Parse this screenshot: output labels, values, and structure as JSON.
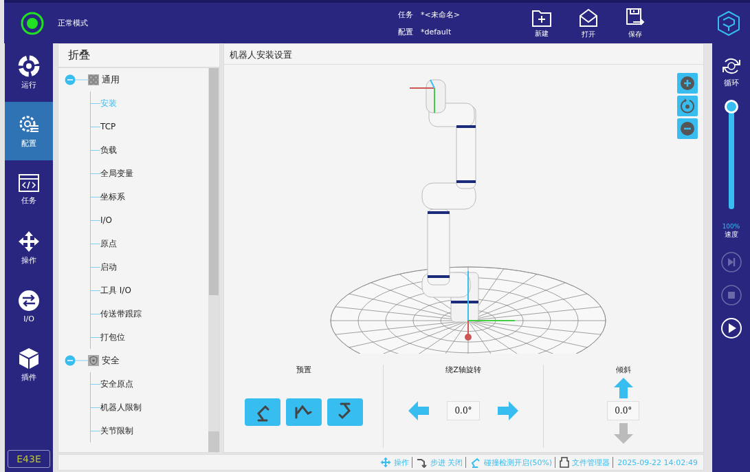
{
  "header": {
    "mode": {
      "label": "正常模式",
      "on": true
    },
    "task": {
      "label": "任务",
      "value": "*<未命名>"
    },
    "config": {
      "label": "配置",
      "value": "*default"
    },
    "actions": [
      {
        "kind": "new",
        "label": "新建"
      },
      {
        "kind": "open",
        "label": "打开"
      },
      {
        "kind": "save",
        "label": "保存"
      }
    ]
  },
  "nav": {
    "items": [
      {
        "kind": "run",
        "label": "运行",
        "selected": false
      },
      {
        "kind": "config",
        "label": "配置",
        "selected": true
      },
      {
        "kind": "task",
        "label": "任务",
        "selected": false
      },
      {
        "kind": "move",
        "label": "操作",
        "selected": false
      },
      {
        "kind": "io",
        "label": "I/O",
        "selected": false
      },
      {
        "kind": "plugin",
        "label": "插件",
        "selected": false
      }
    ],
    "code": "E43E"
  },
  "tree": {
    "title": "折叠",
    "groups": [
      {
        "kind": "general",
        "label": "通用",
        "expanded": true,
        "children": [
          {
            "label": "安装",
            "selected": true
          },
          {
            "label": "TCP",
            "selected": false
          },
          {
            "label": "负载",
            "selected": false
          },
          {
            "label": "全局变量",
            "selected": false
          },
          {
            "label": "坐标系",
            "selected": false
          },
          {
            "label": "I/O",
            "selected": false
          },
          {
            "label": "原点",
            "selected": false
          },
          {
            "label": "启动",
            "selected": false
          },
          {
            "label": "工具 I/O",
            "selected": false
          },
          {
            "label": "传送带跟踪",
            "selected": false
          },
          {
            "label": "打包位",
            "selected": false
          }
        ]
      },
      {
        "kind": "safety",
        "label": "安全",
        "expanded": true,
        "children": [
          {
            "label": "安全原点",
            "selected": false
          },
          {
            "label": "机器人限制",
            "selected": false
          },
          {
            "label": "关节限制",
            "selected": false
          }
        ]
      }
    ]
  },
  "viewer": {
    "title": "机器人安装设置",
    "tools": [
      {
        "kind": "zoom-in"
      },
      {
        "kind": "reset"
      },
      {
        "kind": "zoom-out"
      }
    ]
  },
  "controls": {
    "preset": {
      "title": "预置",
      "buttons": [
        {
          "kind": "floor"
        },
        {
          "kind": "wall"
        },
        {
          "kind": "ceiling"
        }
      ]
    },
    "rotate": {
      "title": "绕Z轴旋转",
      "value": "0.0°"
    },
    "tilt": {
      "title": "倾斜",
      "value": "0.0°",
      "down_disabled": true
    }
  },
  "right": {
    "loop": "循环",
    "speed": {
      "level": 1,
      "reading": "100%",
      "label": "速度"
    },
    "buttons": [
      {
        "kind": "step",
        "disabled": true
      },
      {
        "kind": "stop",
        "disabled": true
      },
      {
        "kind": "play",
        "disabled": false
      }
    ]
  },
  "status_bar": [
    {
      "kind": "move",
      "text": "操作"
    },
    {
      "kind": "step",
      "text": "步进 关闭"
    },
    {
      "kind": "collision",
      "text": "碰撞检测开启(50%)"
    },
    {
      "kind": "files",
      "text": "文件管理器"
    },
    {
      "kind": "time",
      "text": "2025-09-22 14:02:49"
    }
  ]
}
